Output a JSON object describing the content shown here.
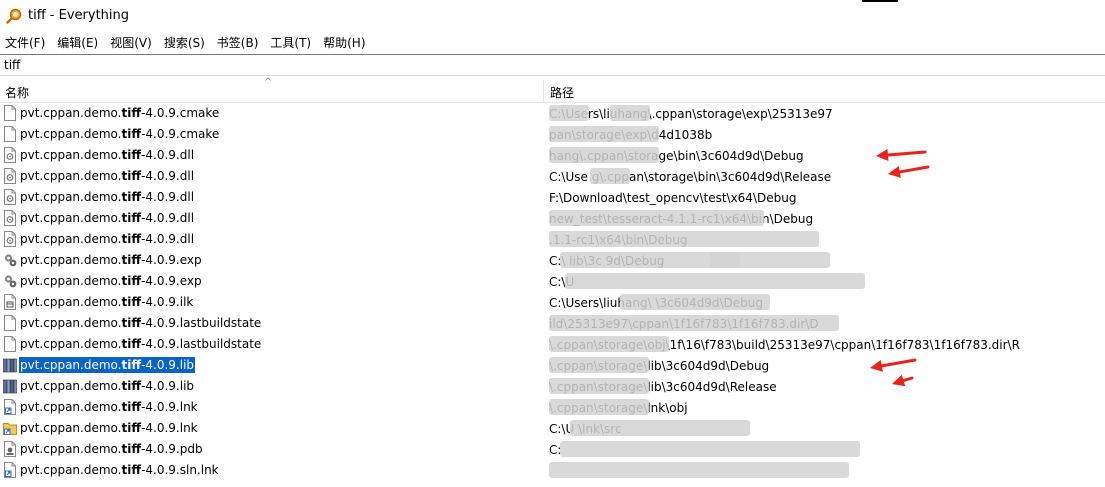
{
  "window": {
    "title": "tiff - Everything"
  },
  "menu": [
    {
      "label": "文件(F)"
    },
    {
      "label": "编辑(E)"
    },
    {
      "label": "视图(V)"
    },
    {
      "label": "搜索(S)"
    },
    {
      "label": "书签(B)"
    },
    {
      "label": "工具(T)"
    },
    {
      "label": "帮助(H)"
    }
  ],
  "search": {
    "value": "tiff"
  },
  "columns": {
    "name": "名称",
    "path": "路径"
  },
  "rows": [
    {
      "pre": "pvt.cppan.demo.",
      "hl": "tiff",
      "post": "-4.0.9.cmake",
      "icon": "document-icon",
      "path": "C:\\Users\\liuhang\\.cppan\\storage\\exp\\25313e97"
    },
    {
      "pre": "pvt.cppan.demo.",
      "hl": "tiff",
      "post": "-4.0.9.cmake",
      "icon": "document-icon",
      "path": "pan\\storage\\exp\\d4d1038b"
    },
    {
      "pre": "pvt.cppan.demo.",
      "hl": "tiff",
      "post": "-4.0.9.dll",
      "icon": "dll-icon",
      "path": "hang\\.cppan\\storage\\bin\\3c604d9d\\Debug"
    },
    {
      "pre": "pvt.cppan.demo.",
      "hl": "tiff",
      "post": "-4.0.9.dll",
      "icon": "dll-icon",
      "path": "C:\\Use  g\\.cppan\\storage\\bin\\3c604d9d\\Release"
    },
    {
      "pre": "pvt.cppan.demo.",
      "hl": "tiff",
      "post": "-4.0.9.dll",
      "icon": "dll-icon",
      "path": "F:\\Download\\test_opencv\\test\\x64\\Debug"
    },
    {
      "pre": "pvt.cppan.demo.",
      "hl": "tiff",
      "post": "-4.0.9.dll",
      "icon": "dll-icon",
      "path": "new_test\\tesseract-4.1.1-rc1\\x64\\bin\\Debug"
    },
    {
      "pre": "pvt.cppan.demo.",
      "hl": "tiff",
      "post": "-4.0.9.dll",
      "icon": "dll-icon",
      "path": ".1.1-rc1\\x64\\bin\\Debug"
    },
    {
      "pre": "pvt.cppan.demo.",
      "hl": "tiff",
      "post": "-4.0.9.exp",
      "icon": "gear-file-icon",
      "path": "C:\\  lib\\3c  9d\\Debug"
    },
    {
      "pre": "pvt.cppan.demo.",
      "hl": "tiff",
      "post": "-4.0.9.exp",
      "icon": "gear-file-icon",
      "path": "C:\\U"
    },
    {
      "pre": "pvt.cppan.demo.",
      "hl": "tiff",
      "post": "-4.0.9.ilk",
      "icon": "ilk-file-icon",
      "path": "C:\\Users\\liuhang\\  \\3c604d9d\\Debug"
    },
    {
      "pre": "pvt.cppan.demo.",
      "hl": "tiff",
      "post": "-4.0.9.lastbuildstate",
      "icon": "document-icon",
      "path": "ild\\25313e97\\cppan\\1f16f783\\1f16f783.dir\\D"
    },
    {
      "pre": "pvt.cppan.demo.",
      "hl": "tiff",
      "post": "-4.0.9.lastbuildstate",
      "icon": "document-icon",
      "path": "\\.cppan\\storage\\obj\\1f\\16\\f783\\build\\25313e97\\cppan\\1f16f783\\1f16f783.dir\\R"
    },
    {
      "pre": "pvt.cppan.demo.",
      "hl": "tiff",
      "post": "-4.0.9.lib",
      "icon": "library-icon",
      "path": "\\.cppan\\storage\\lib\\3c604d9d\\Debug",
      "selected": true
    },
    {
      "pre": "pvt.cppan.demo.",
      "hl": "tiff",
      "post": "-4.0.9.lib",
      "icon": "library-icon",
      "path": "\\.cppan\\storage\\lib\\3c604d9d\\Release"
    },
    {
      "pre": "pvt.cppan.demo.",
      "hl": "tiff",
      "post": "-4.0.9.lnk",
      "icon": "shortcut-icon",
      "path": "\\.cppan\\storage\\lnk\\obj"
    },
    {
      "pre": "pvt.cppan.demo.",
      "hl": "tiff",
      "post": "-4.0.9.lnk",
      "icon": "folder-shortcut-icon",
      "path": "C:\\U  \\lnk\\src"
    },
    {
      "pre": "pvt.cppan.demo.",
      "hl": "tiff",
      "post": "-4.0.9.pdb",
      "icon": "pdb-file-icon",
      "path": "C:"
    },
    {
      "pre": "pvt.cppan.demo.",
      "hl": "tiff",
      "post": "-4.0.9.sln.lnk",
      "icon": "shortcut-icon",
      "path": ""
    }
  ],
  "colors": {
    "selection": "#0a64c8",
    "annotation_arrow": "#e8231c"
  }
}
